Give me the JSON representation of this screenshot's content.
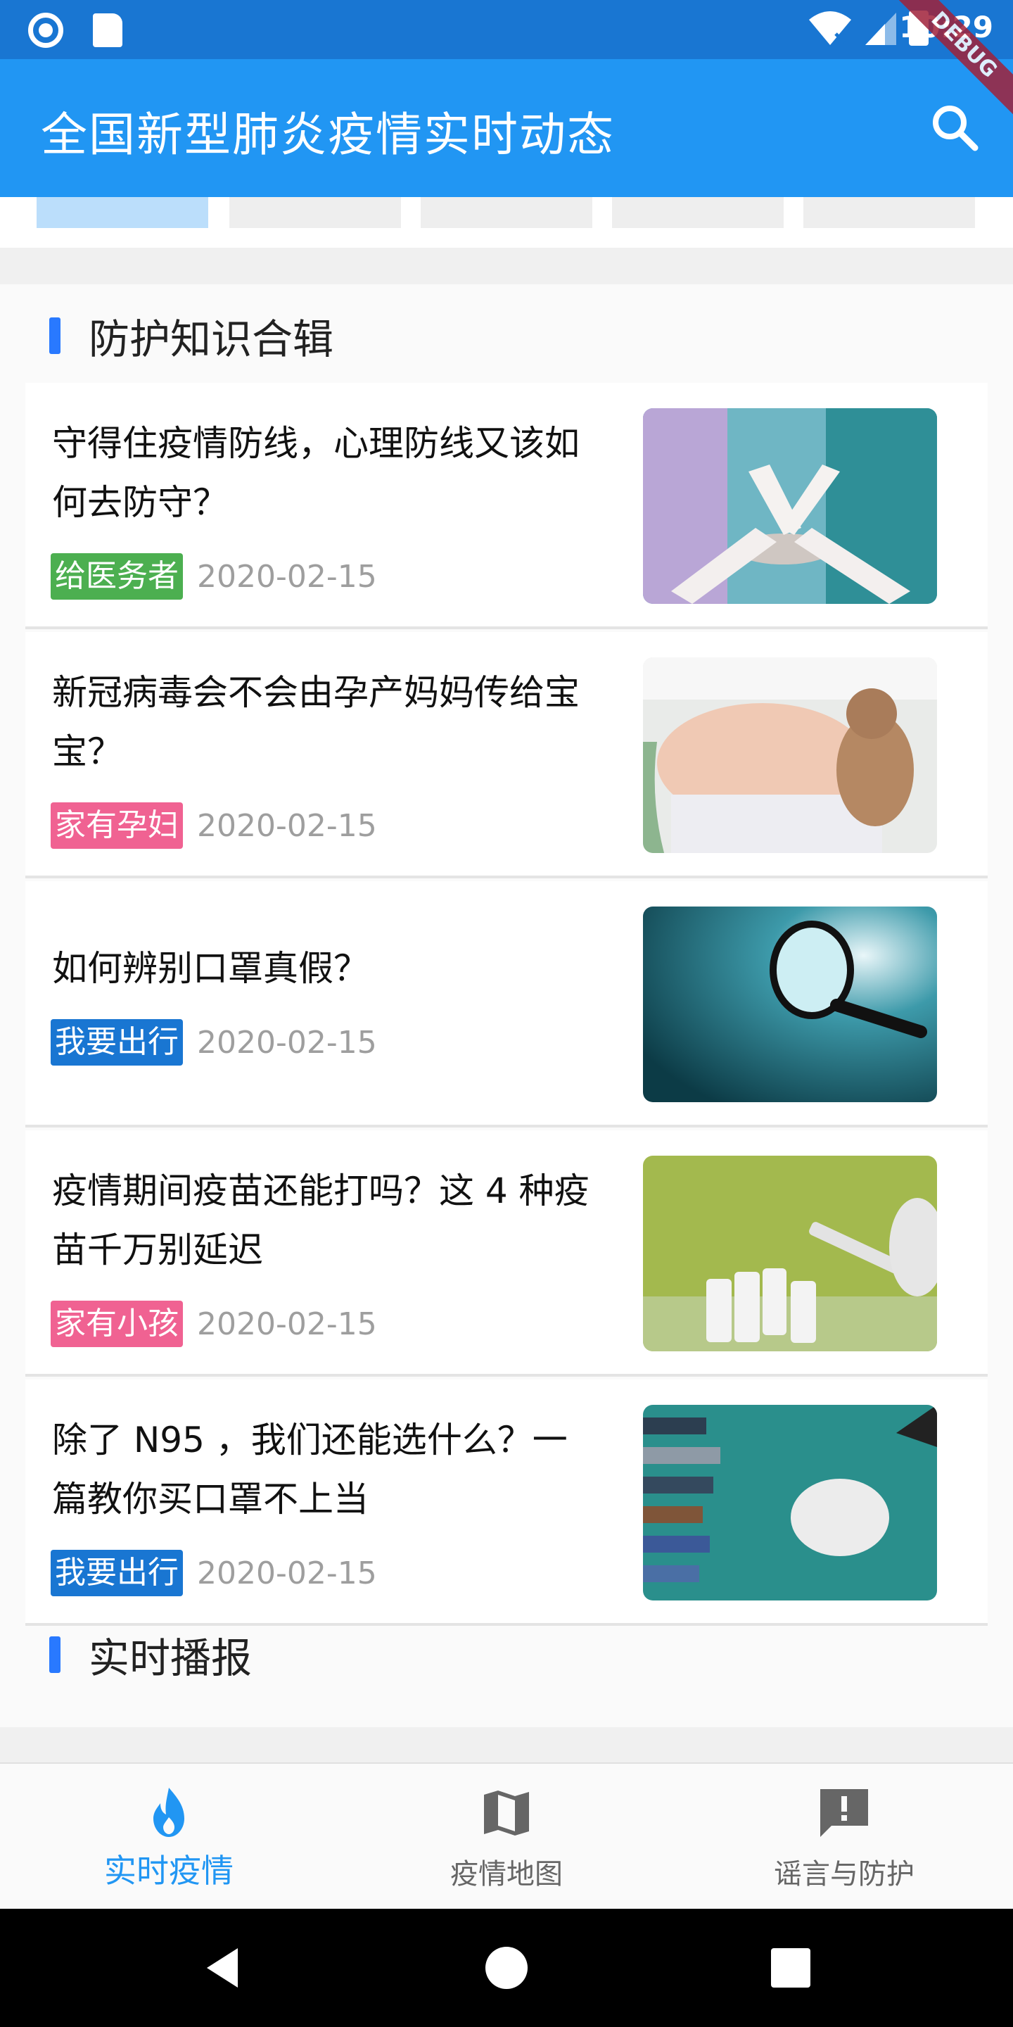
{
  "status_bar": {
    "time": "10:29"
  },
  "debug_banner": "DEBUG",
  "app_bar": {
    "title": "全国新型肺炎疫情实时动态"
  },
  "sections": {
    "protection": {
      "title": "防护知识合辑"
    },
    "live": {
      "title": "实时播报"
    }
  },
  "articles": [
    {
      "title": "守得住疫情防线，心理防线又该如何去防守？",
      "tag": "给医务者",
      "tag_color": "#4caf50",
      "date": "2020-02-15",
      "image": "hands-together-image"
    },
    {
      "title": "新冠病毒会不会由孕产妈妈传给宝宝？",
      "tag": "家有孕妇",
      "tag_color": "#f06292",
      "date": "2020-02-15",
      "image": "pregnant-belly-image"
    },
    {
      "title": "如何辨别口罩真假？",
      "tag": "我要出行",
      "tag_color": "#1976d2",
      "date": "2020-02-15",
      "image": "magnifying-glass-image"
    },
    {
      "title": "疫情期间疫苗还能打吗？这 4 种疫苗千万别延迟",
      "tag": "家有小孩",
      "tag_color": "#f06292",
      "date": "2020-02-15",
      "image": "vaccine-syringe-image"
    },
    {
      "title": "除了 N95 ，我们还能选什么？一篇教你买口罩不上当",
      "tag": "我要出行",
      "tag_color": "#1976d2",
      "date": "2020-02-15",
      "image": "mask-hands-image"
    }
  ],
  "bottom_nav": [
    {
      "label": "实时疫情",
      "icon": "flame-icon",
      "active": true
    },
    {
      "label": "疫情地图",
      "icon": "map-icon",
      "active": false
    },
    {
      "label": "谣言与防护",
      "icon": "alert-message-icon",
      "active": false
    }
  ],
  "colors": {
    "primary": "#2196f3",
    "status_bar": "#1976d2",
    "accent_bar": "#2979ff"
  }
}
